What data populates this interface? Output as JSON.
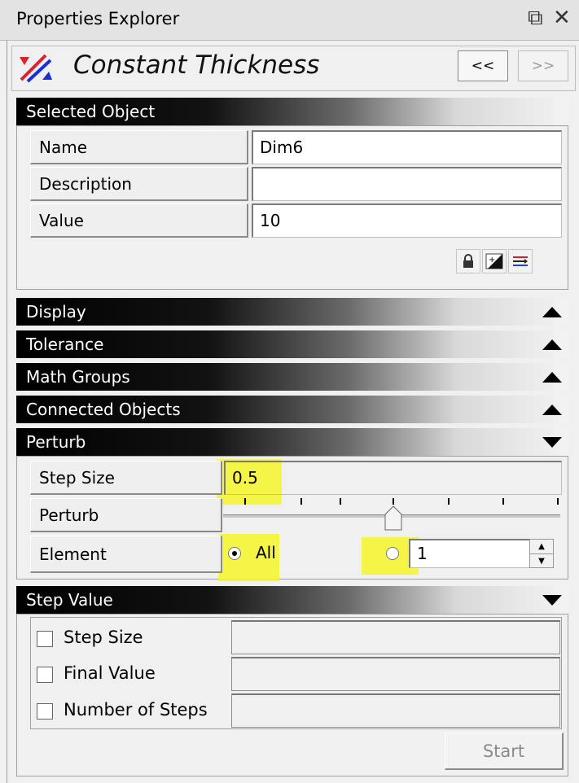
{
  "window": {
    "title": "Properties Explorer",
    "restore_glyph": "⧉",
    "close_glyph": "✕"
  },
  "command": {
    "title": "Constant Thickness",
    "icon": "constant-thickness-icon",
    "prev_label": "<<",
    "next_label": ">>"
  },
  "selected_object": {
    "header": "Selected Object",
    "fields": [
      {
        "label": "Name",
        "value": "Dim6"
      },
      {
        "label": "Description",
        "value": ""
      },
      {
        "label": "Value",
        "value": "10"
      }
    ],
    "toolbar": [
      "lock-icon",
      "edit-value-icon",
      "connect-icon"
    ]
  },
  "collapsed_sections": [
    {
      "label": "Display",
      "state": "collapsed"
    },
    {
      "label": "Tolerance",
      "state": "collapsed"
    },
    {
      "label": "Math Groups",
      "state": "collapsed"
    },
    {
      "label": "Connected Objects",
      "state": "collapsed"
    }
  ],
  "perturb": {
    "header": "Perturb",
    "step_size_label": "Step Size",
    "step_size_value": "0.5",
    "perturb_label": "Perturb",
    "slider_position": 0.5,
    "element_label": "Element",
    "element_all_label": "All",
    "element_all_selected": true,
    "element_index_value": "1"
  },
  "step_value": {
    "header": "Step Value",
    "options": [
      {
        "label": "Step Size",
        "checked": false,
        "value": ""
      },
      {
        "label": "Final Value",
        "checked": false,
        "value": ""
      },
      {
        "label": "Number of Steps",
        "checked": false,
        "value": ""
      }
    ],
    "start_label": "Start"
  },
  "colors": {
    "highlight": "#f6f62a",
    "header_gradient_start": "#000000",
    "logo_red": "#e0202a",
    "logo_blue": "#1c2fd0"
  }
}
